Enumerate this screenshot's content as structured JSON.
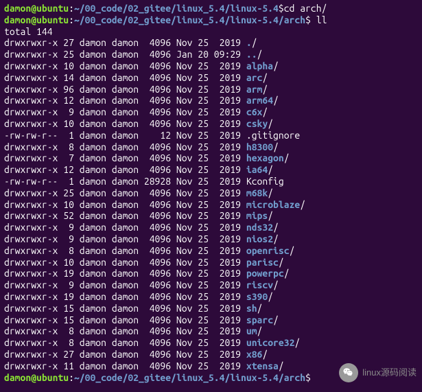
{
  "top_line": {
    "user": "damon",
    "at": "@",
    "host": "ubuntu",
    "colon": ":",
    "path_fragment": "~/00_code/02_gitee/linux_5.4/linux-5.4",
    "prompt": "$",
    "cmd_fragment": "cd arch/"
  },
  "prompt1": {
    "user": "damon",
    "at": "@",
    "host": "ubuntu",
    "colon": ":",
    "path": "~/00_code/02_gitee/linux_5.4/linux-5.4/arch",
    "prompt": "$",
    "cmd": " ll"
  },
  "total_line": "total 144",
  "entries": [
    {
      "perm": "drwxrwxr-x",
      "links": "27",
      "user": "damon",
      "group": "damon",
      "size": " 4096",
      "month": "Nov",
      "day": "25",
      "time": " 2019",
      "name": ".",
      "type": "dir"
    },
    {
      "perm": "drwxrwxr-x",
      "links": "25",
      "user": "damon",
      "group": "damon",
      "size": " 4096",
      "month": "Jan",
      "day": "20",
      "time": "09:29",
      "name": "..",
      "type": "dir"
    },
    {
      "perm": "drwxrwxr-x",
      "links": "10",
      "user": "damon",
      "group": "damon",
      "size": " 4096",
      "month": "Nov",
      "day": "25",
      "time": " 2019",
      "name": "alpha",
      "type": "dir"
    },
    {
      "perm": "drwxrwxr-x",
      "links": "14",
      "user": "damon",
      "group": "damon",
      "size": " 4096",
      "month": "Nov",
      "day": "25",
      "time": " 2019",
      "name": "arc",
      "type": "dir"
    },
    {
      "perm": "drwxrwxr-x",
      "links": "96",
      "user": "damon",
      "group": "damon",
      "size": " 4096",
      "month": "Nov",
      "day": "25",
      "time": " 2019",
      "name": "arm",
      "type": "dir"
    },
    {
      "perm": "drwxrwxr-x",
      "links": "12",
      "user": "damon",
      "group": "damon",
      "size": " 4096",
      "month": "Nov",
      "day": "25",
      "time": " 2019",
      "name": "arm64",
      "type": "dir"
    },
    {
      "perm": "drwxrwxr-x",
      "links": " 9",
      "user": "damon",
      "group": "damon",
      "size": " 4096",
      "month": "Nov",
      "day": "25",
      "time": " 2019",
      "name": "c6x",
      "type": "dir"
    },
    {
      "perm": "drwxrwxr-x",
      "links": "10",
      "user": "damon",
      "group": "damon",
      "size": " 4096",
      "month": "Nov",
      "day": "25",
      "time": " 2019",
      "name": "csky",
      "type": "dir"
    },
    {
      "perm": "-rw-rw-r--",
      "links": " 1",
      "user": "damon",
      "group": "damon",
      "size": "   12",
      "month": "Nov",
      "day": "25",
      "time": " 2019",
      "name": ".gitignore",
      "type": "file"
    },
    {
      "perm": "drwxrwxr-x",
      "links": " 8",
      "user": "damon",
      "group": "damon",
      "size": " 4096",
      "month": "Nov",
      "day": "25",
      "time": " 2019",
      "name": "h8300",
      "type": "dir"
    },
    {
      "perm": "drwxrwxr-x",
      "links": " 7",
      "user": "damon",
      "group": "damon",
      "size": " 4096",
      "month": "Nov",
      "day": "25",
      "time": " 2019",
      "name": "hexagon",
      "type": "dir"
    },
    {
      "perm": "drwxrwxr-x",
      "links": "12",
      "user": "damon",
      "group": "damon",
      "size": " 4096",
      "month": "Nov",
      "day": "25",
      "time": " 2019",
      "name": "ia64",
      "type": "dir"
    },
    {
      "perm": "-rw-rw-r--",
      "links": " 1",
      "user": "damon",
      "group": "damon",
      "size": "28928",
      "month": "Nov",
      "day": "25",
      "time": " 2019",
      "name": "Kconfig",
      "type": "file"
    },
    {
      "perm": "drwxrwxr-x",
      "links": "25",
      "user": "damon",
      "group": "damon",
      "size": " 4096",
      "month": "Nov",
      "day": "25",
      "time": " 2019",
      "name": "m68k",
      "type": "dir"
    },
    {
      "perm": "drwxrwxr-x",
      "links": "10",
      "user": "damon",
      "group": "damon",
      "size": " 4096",
      "month": "Nov",
      "day": "25",
      "time": " 2019",
      "name": "microblaze",
      "type": "dir"
    },
    {
      "perm": "drwxrwxr-x",
      "links": "52",
      "user": "damon",
      "group": "damon",
      "size": " 4096",
      "month": "Nov",
      "day": "25",
      "time": " 2019",
      "name": "mips",
      "type": "dir"
    },
    {
      "perm": "drwxrwxr-x",
      "links": " 9",
      "user": "damon",
      "group": "damon",
      "size": " 4096",
      "month": "Nov",
      "day": "25",
      "time": " 2019",
      "name": "nds32",
      "type": "dir"
    },
    {
      "perm": "drwxrwxr-x",
      "links": " 9",
      "user": "damon",
      "group": "damon",
      "size": " 4096",
      "month": "Nov",
      "day": "25",
      "time": " 2019",
      "name": "nios2",
      "type": "dir"
    },
    {
      "perm": "drwxrwxr-x",
      "links": " 8",
      "user": "damon",
      "group": "damon",
      "size": " 4096",
      "month": "Nov",
      "day": "25",
      "time": " 2019",
      "name": "openrisc",
      "type": "dir"
    },
    {
      "perm": "drwxrwxr-x",
      "links": "10",
      "user": "damon",
      "group": "damon",
      "size": " 4096",
      "month": "Nov",
      "day": "25",
      "time": " 2019",
      "name": "parisc",
      "type": "dir"
    },
    {
      "perm": "drwxrwxr-x",
      "links": "19",
      "user": "damon",
      "group": "damon",
      "size": " 4096",
      "month": "Nov",
      "day": "25",
      "time": " 2019",
      "name": "powerpc",
      "type": "dir"
    },
    {
      "perm": "drwxrwxr-x",
      "links": " 9",
      "user": "damon",
      "group": "damon",
      "size": " 4096",
      "month": "Nov",
      "day": "25",
      "time": " 2019",
      "name": "riscv",
      "type": "dir"
    },
    {
      "perm": "drwxrwxr-x",
      "links": "19",
      "user": "damon",
      "group": "damon",
      "size": " 4096",
      "month": "Nov",
      "day": "25",
      "time": " 2019",
      "name": "s390",
      "type": "dir"
    },
    {
      "perm": "drwxrwxr-x",
      "links": "15",
      "user": "damon",
      "group": "damon",
      "size": " 4096",
      "month": "Nov",
      "day": "25",
      "time": " 2019",
      "name": "sh",
      "type": "dir"
    },
    {
      "perm": "drwxrwxr-x",
      "links": "15",
      "user": "damon",
      "group": "damon",
      "size": " 4096",
      "month": "Nov",
      "day": "25",
      "time": " 2019",
      "name": "sparc",
      "type": "dir"
    },
    {
      "perm": "drwxrwxr-x",
      "links": " 8",
      "user": "damon",
      "group": "damon",
      "size": " 4096",
      "month": "Nov",
      "day": "25",
      "time": " 2019",
      "name": "um",
      "type": "dir"
    },
    {
      "perm": "drwxrwxr-x",
      "links": " 8",
      "user": "damon",
      "group": "damon",
      "size": " 4096",
      "month": "Nov",
      "day": "25",
      "time": " 2019",
      "name": "unicore32",
      "type": "dir"
    },
    {
      "perm": "drwxrwxr-x",
      "links": "27",
      "user": "damon",
      "group": "damon",
      "size": " 4096",
      "month": "Nov",
      "day": "25",
      "time": " 2019",
      "name": "x86",
      "type": "dir"
    },
    {
      "perm": "drwxrwxr-x",
      "links": "11",
      "user": "damon",
      "group": "damon",
      "size": " 4096",
      "month": "Nov",
      "day": "25",
      "time": " 2019",
      "name": "xtensa",
      "type": "dir"
    }
  ],
  "bottom_line": {
    "user": "damon",
    "at": "@",
    "host": "ubuntu",
    "colon": ":",
    "path_fragment": "~/00_code/02_gitee/linux_5.4/linux-5.4/arch",
    "prompt": "$"
  },
  "badge": {
    "text": "linux源码阅读"
  }
}
